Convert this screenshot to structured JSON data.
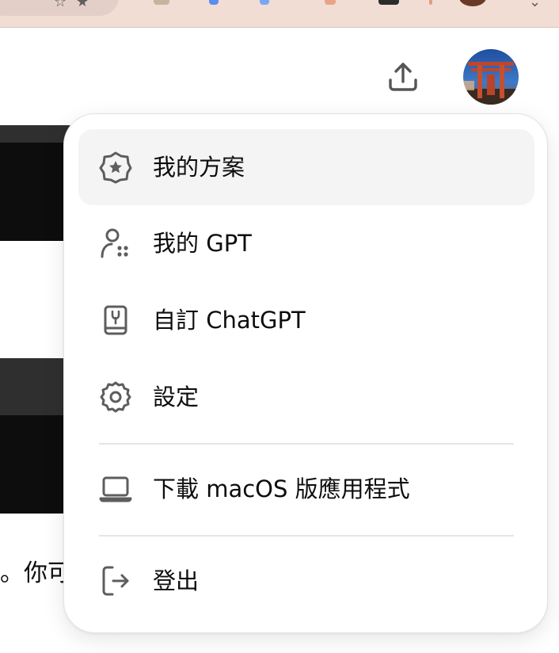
{
  "header": {
    "share_icon": "share-upload-icon",
    "avatar_icon": "torii-gate-photo"
  },
  "background": {
    "partial_text": "。你可"
  },
  "menu": {
    "items": [
      {
        "label": "我的方案",
        "icon": "plan-badge-icon",
        "active": true
      },
      {
        "label": "我的 GPT",
        "icon": "my-gpts-icon",
        "active": false
      },
      {
        "label": "自訂 ChatGPT",
        "icon": "customize-book-icon",
        "active": false
      },
      {
        "label": "設定",
        "icon": "settings-gear-icon",
        "active": false
      },
      {
        "label": "下載 macOS 版應用程式",
        "icon": "laptop-icon",
        "active": false
      },
      {
        "label": "登出",
        "icon": "logout-icon",
        "active": false
      }
    ]
  },
  "colors": {
    "chrome_bar": "#f2ddd5",
    "menu_bg": "#ffffff",
    "active_item_bg": "#f4f4f4",
    "icon": "#5d5d5d",
    "text": "#0d0d0d",
    "divider": "#e5e5e5"
  }
}
